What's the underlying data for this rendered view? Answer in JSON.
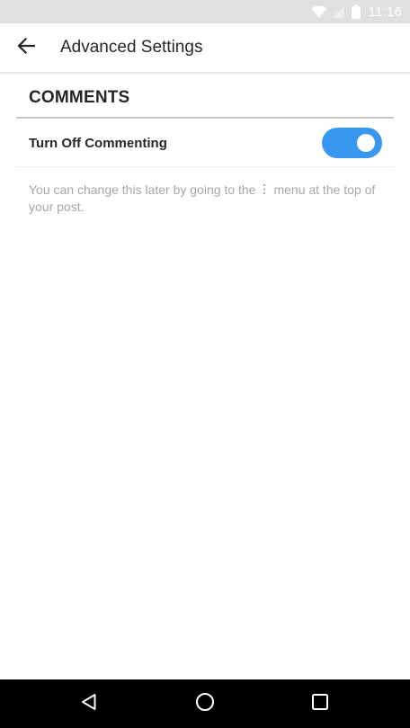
{
  "status_bar": {
    "time": "11:16",
    "icons": [
      "wifi-icon",
      "signal-icon",
      "battery-icon"
    ]
  },
  "app_bar": {
    "back_icon": "arrow-back-icon",
    "title": "Advanced Settings"
  },
  "comments_section": {
    "header": "COMMENTS",
    "setting": {
      "label": "Turn Off Commenting",
      "toggle_on": true,
      "toggle_color": "#3897f0"
    },
    "help_text_before": "You can change this later by going to the",
    "help_icon": "more-vertical-icon",
    "help_text_after": "menu at the top of your post."
  },
  "nav_bar": {
    "buttons": [
      "back-triangle-icon",
      "home-circle-icon",
      "recents-square-icon"
    ]
  }
}
